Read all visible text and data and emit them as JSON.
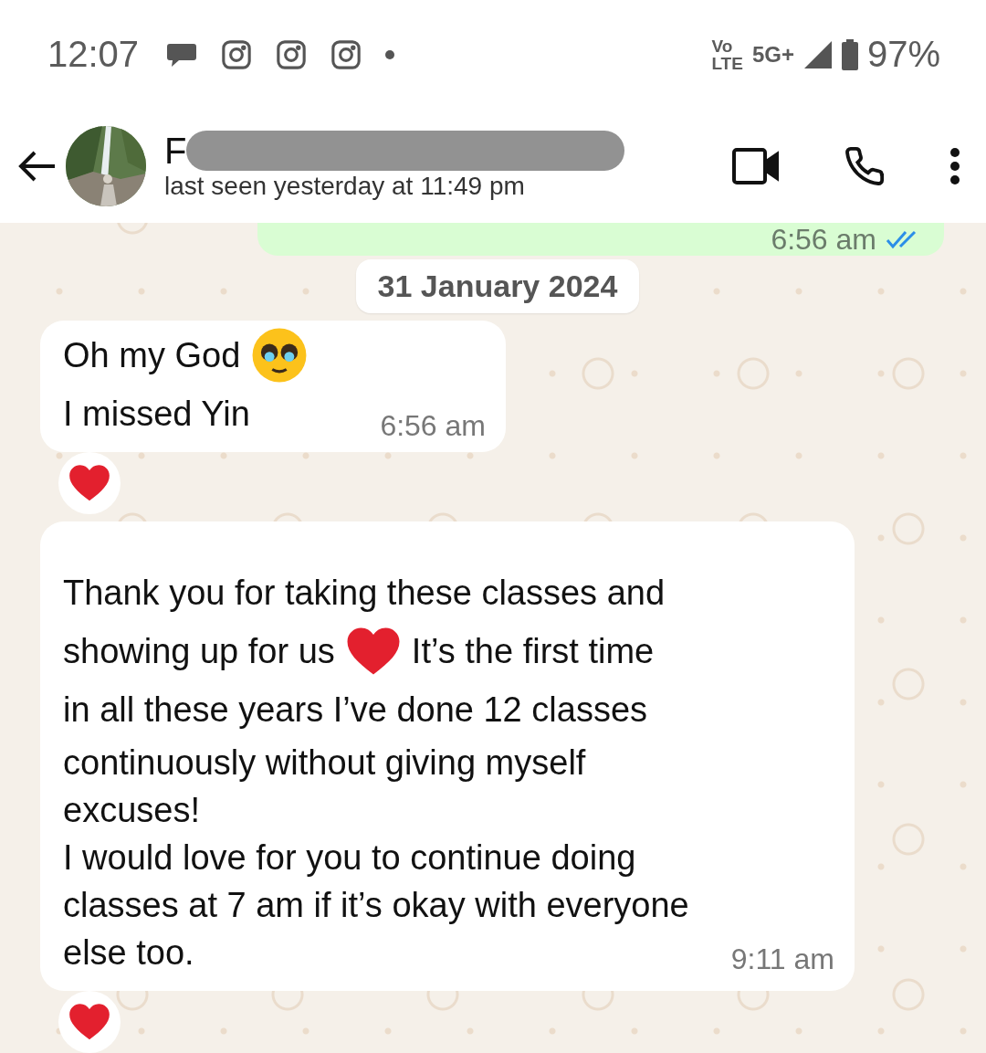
{
  "status_bar": {
    "time": "12:07",
    "notification_icons": [
      {
        "kind": "chat"
      },
      {
        "kind": "camera"
      },
      {
        "kind": "camera"
      },
      {
        "kind": "camera"
      },
      {
        "kind": "dot"
      }
    ],
    "network_top": "Vo",
    "network_bottom": "LTE",
    "network_type": "5G+",
    "battery": "97%"
  },
  "header": {
    "name": "F",
    "status": "last seen yesterday at 11:49 pm",
    "name_redacted": true
  },
  "messages": [
    {
      "kind": "outgoing_partial",
      "time": "6:56 am",
      "read": true
    },
    {
      "kind": "date",
      "text": "31 January 2024"
    },
    {
      "kind": "incoming",
      "lines": [
        [
          {
            "kind": "text",
            "text": "Oh my God"
          },
          {
            "kind": "face"
          }
        ],
        [
          {
            "kind": "text",
            "text": "I missed Yin"
          }
        ]
      ],
      "time": "6:56 am",
      "reaction": true
    },
    {
      "kind": "incoming_long",
      "lines": [
        [
          {
            "kind": "text",
            "text": "Thank you for taking these classes and"
          }
        ],
        [
          {
            "kind": "text",
            "text": "showing up for us"
          },
          {
            "kind": "heart"
          },
          {
            "kind": "text",
            "text": "It’s the first time"
          }
        ],
        [
          {
            "kind": "text",
            "text": "in all these years I’ve done 12 classes"
          }
        ],
        [
          {
            "kind": "text",
            "text": "continuously without giving myself"
          }
        ],
        [
          {
            "kind": "text",
            "text": "excuses!"
          }
        ],
        [
          {
            "kind": "text",
            "text": "I would love for you to continue doing"
          }
        ],
        [
          {
            "kind": "text",
            "text": "classes at 7 am if it’s okay with everyone"
          }
        ],
        [
          {
            "kind": "text",
            "text": "else too."
          }
        ]
      ],
      "time": "9:11 am",
      "reaction": true
    }
  ]
}
